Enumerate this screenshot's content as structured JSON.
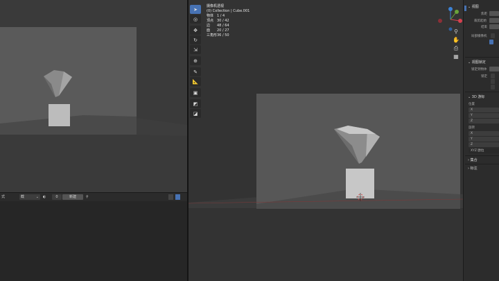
{
  "left_bottom_bar": {
    "mode_label": "式",
    "dropdown_value": "截",
    "gear_value": "0",
    "link_label": "新建"
  },
  "overlay": {
    "title": "摄像机透视",
    "collection": "(0) Collection | Cube.001",
    "stats": [
      {
        "label": "物体",
        "value": "1 / 4"
      },
      {
        "label": "顶点",
        "value": "30 / 42"
      },
      {
        "label": "边",
        "value": "48 / 64"
      },
      {
        "label": "面",
        "value": "20 / 27"
      },
      {
        "label": "三角形",
        "value": "36 / 50"
      }
    ]
  },
  "npanel": {
    "view_header": "视图",
    "focal_label": "焦距",
    "clip_start_label": "裁剪起始",
    "clip_end_label": "结束",
    "local_camera_label": "局部摄像机",
    "view_lock_header": "视图锁定",
    "lock_to_object_label": "锁定到物体",
    "lock_label": "锁定",
    "cursor_header": "3D 游标",
    "location_label": "位置",
    "rotation_label": "旋转",
    "axes_x": "X",
    "axes_y": "Y",
    "axes_z": "Z",
    "rotation_mode": "XYZ 欧拉",
    "collections_header": "集合",
    "annotations_header": "标注"
  },
  "colors": {
    "accent": "#4772b3",
    "gizmo_x": "#d8414f",
    "gizmo_y": "#6aa33a",
    "gizmo_z": "#3c82d6"
  }
}
